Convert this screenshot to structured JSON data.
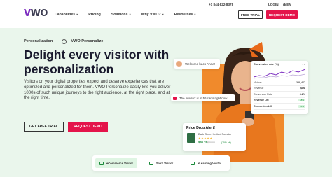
{
  "header": {
    "logo": "VWO",
    "nav": [
      "Capabilities",
      "Pricing",
      "Solutions",
      "Why VWO?",
      "Resources"
    ],
    "nav_dropdowns": [
      true,
      false,
      true,
      true,
      true
    ],
    "phone": "+1 844-822-8378",
    "login": "LOGIN",
    "lang": "EN",
    "free_trial": "FREE TRIAL",
    "request_demo": "REQUEST DEMO"
  },
  "breadcrumb": {
    "parent": "Personalization",
    "current": "VWO Personalize"
  },
  "hero": {
    "headline": "Delight every visitor with personalization",
    "description": "Visitors on your digital properties expect and deserve experiences that are optimized and personalized for them. VWO Personalize easily lets you deliver 1000s of such unique journeys to the right audience, at the right place, and at the right time.",
    "cta_trial": "GET FREE TRIAL",
    "cta_demo": "REQUEST DEMO"
  },
  "cards": {
    "welcome": "Welcome back Anna!",
    "product": "The product is in 56 carts right now",
    "stats": {
      "title": "Conversion rate (%)",
      "rows": [
        {
          "label": "Visitors",
          "value": "200,467"
        },
        {
          "label": "Revenue",
          "value": "$8M"
        },
        {
          "label": "Conversion Rate",
          "value": "3.2%"
        },
        {
          "label": "Revenue Lift",
          "value": "+8%"
        },
        {
          "label": "Conversion Lift",
          "value": "+6%"
        }
      ]
    },
    "price": {
      "title": "Price Drop Alert!",
      "product": "Dark Green Knitted Sweater",
      "stars": "★★★★★",
      "now": "$30.25",
      "was": "$40.00",
      "off": "(25% off)"
    }
  },
  "visitor_tabs": [
    "eCommerce Visitor",
    "SaaS Visitor",
    "eLearning Visitor"
  ],
  "colors": {
    "accent": "#e4144a",
    "background": "#eaf6ec",
    "brand_purple": "#7b2cbf",
    "success": "#1a8a3a"
  }
}
